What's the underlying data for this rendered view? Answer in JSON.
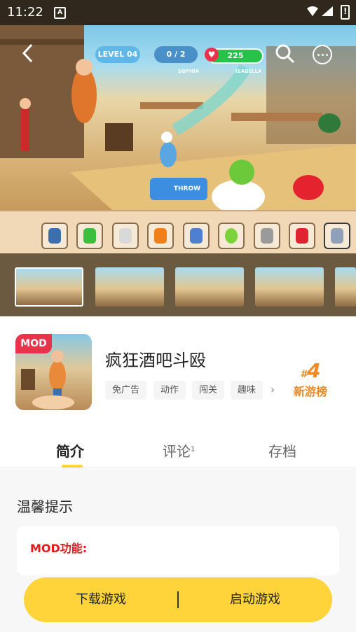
{
  "status_bar": {
    "time": "11:22",
    "notification_glyph": "A"
  },
  "game_hud": {
    "level": "LEVEL 04",
    "players": "0 / 2",
    "health": "225",
    "player1": "SOPHIA",
    "player2": "ISABELLA",
    "throw_label": "THROW"
  },
  "tray_items": [
    "bottle-icon",
    "bucket-icon",
    "cup-icon",
    "fish-icon",
    "vase-icon",
    "ball-icon",
    "spatula-icon",
    "potion-icon",
    "slippers-icon"
  ],
  "app": {
    "mod_badge": "MOD",
    "title": "疯狂酒吧斗殴",
    "tags": [
      "免广告",
      "动作",
      "闯关",
      "趣味"
    ],
    "rank_hash": "#",
    "rank_number": "4",
    "rank_label": "新游榜"
  },
  "tabs": {
    "intro": "简介",
    "comments": "评论",
    "comments_count": "1",
    "saves": "存档"
  },
  "content": {
    "tips_title": "温馨提示",
    "mod_feature_label": "MOD功能:"
  },
  "actions": {
    "download": "下载游戏",
    "launch": "启动游戏"
  },
  "colors": {
    "accent": "#ffd43a",
    "rank": "#f08a24",
    "mod_red": "#e11b1b"
  }
}
